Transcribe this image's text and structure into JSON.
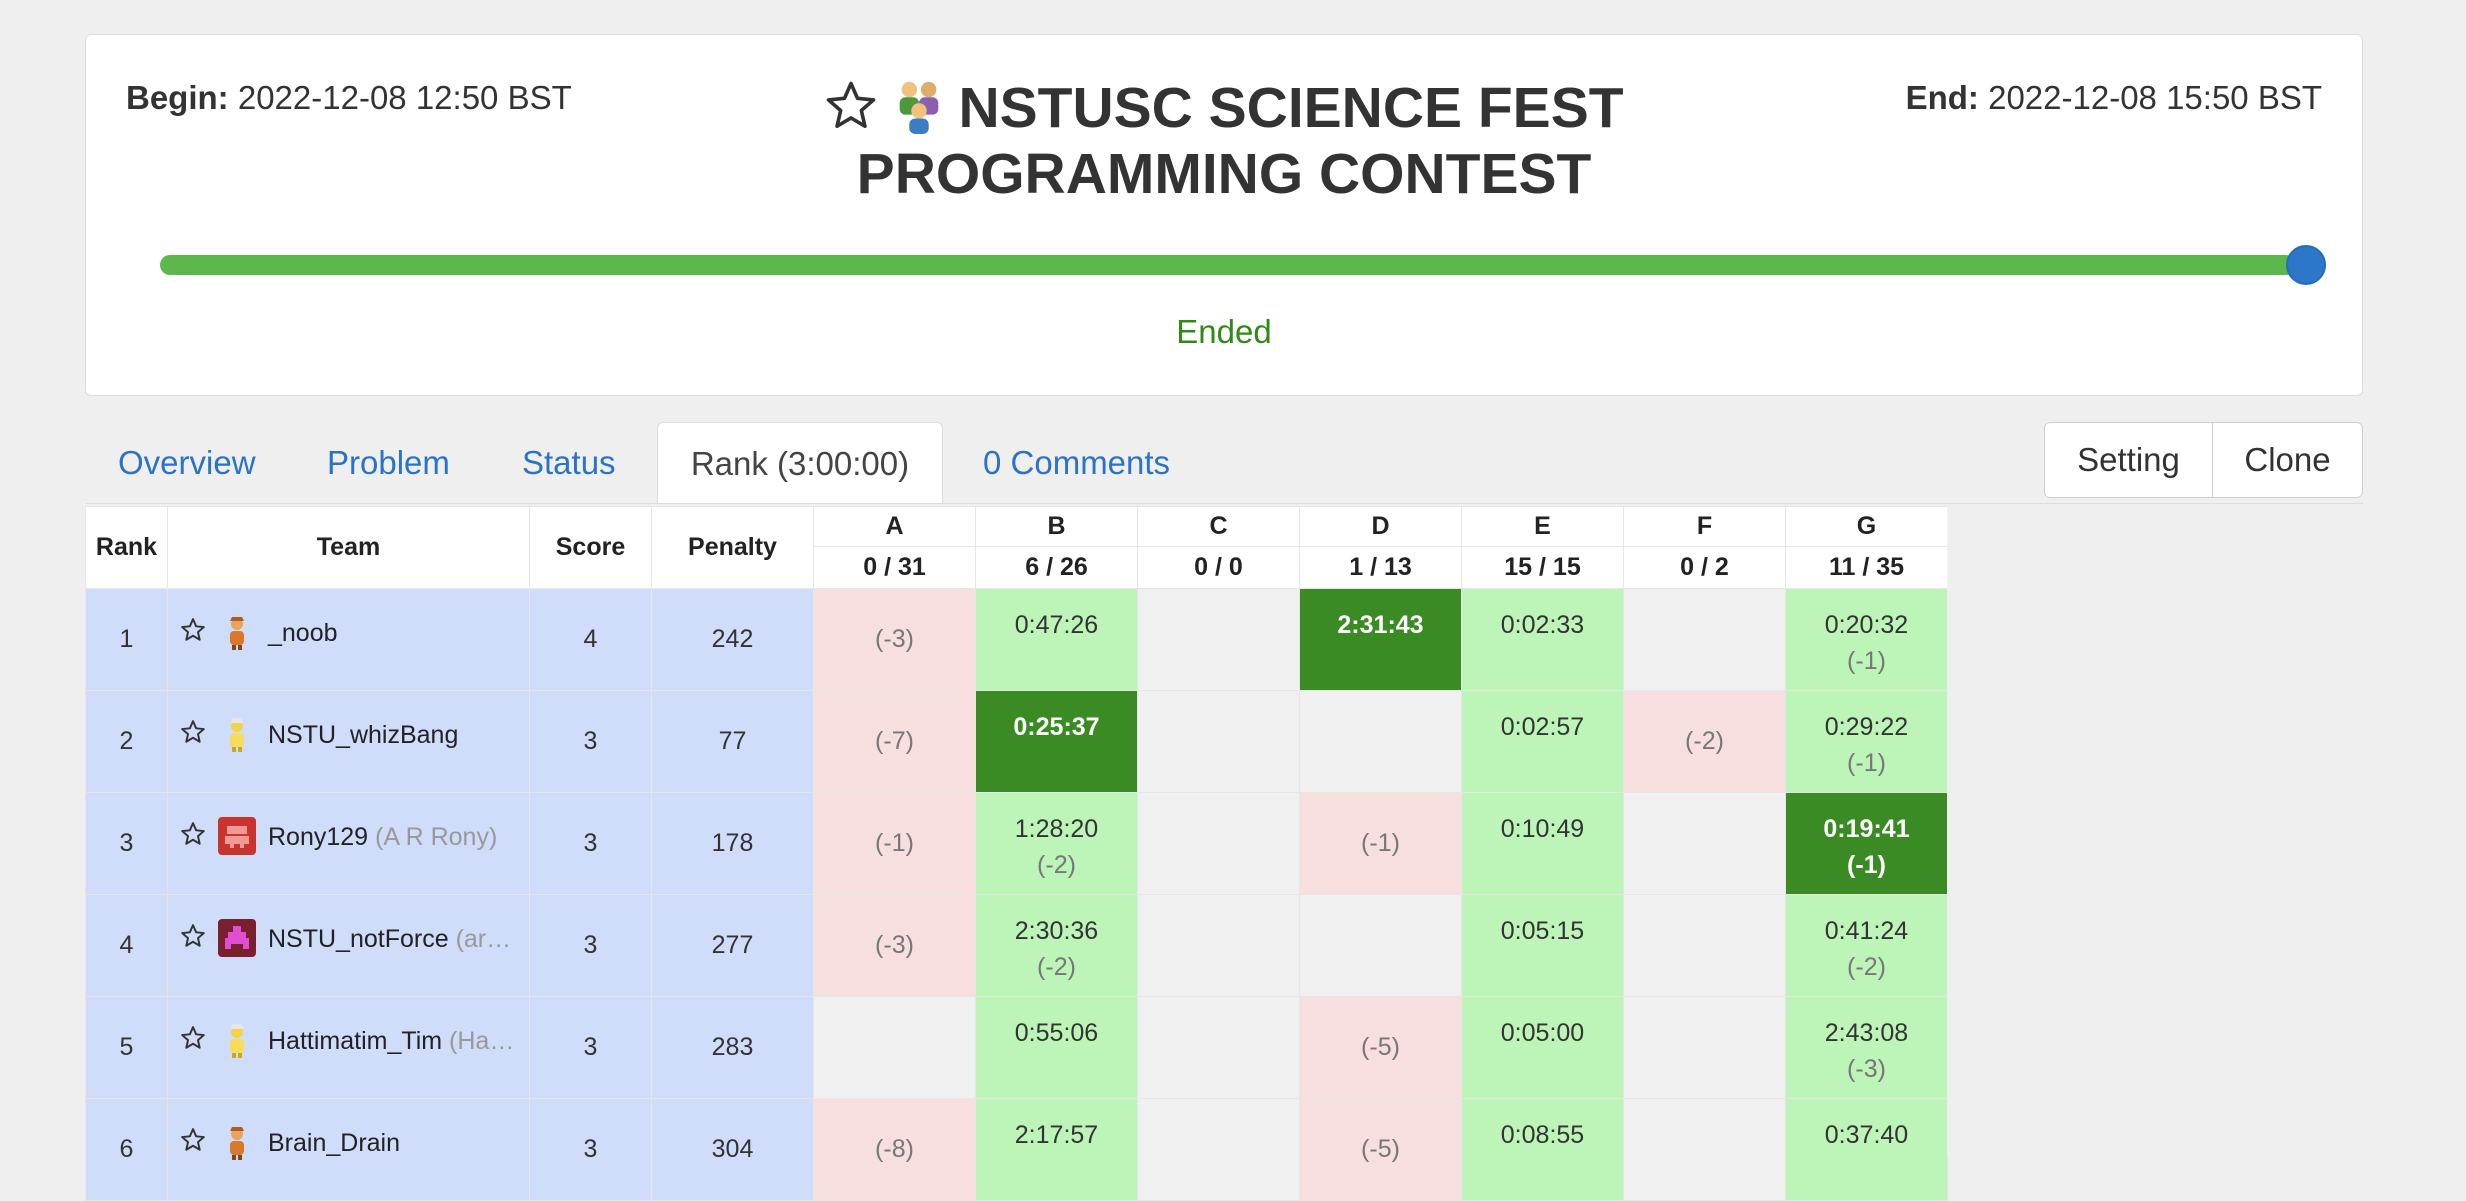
{
  "contest": {
    "begin_label": "Begin:",
    "begin_value": "2022-12-08 12:50 BST",
    "end_label": "End:",
    "end_value": "2022-12-08 15:50 BST",
    "title_line1": "NSTUSC SCIENCE FEST",
    "title_line2": "PROGRAMMING CONTEST",
    "progress": 1.0,
    "status": "Ended",
    "accent_color": "#5cb84c"
  },
  "tabs": [
    {
      "label": "Overview"
    },
    {
      "label": "Problem"
    },
    {
      "label": "Status"
    },
    {
      "label": "Rank (3:00:00)",
      "active": true
    },
    {
      "label": "0 Comments"
    }
  ],
  "buttons": {
    "setting": "Setting",
    "clone": "Clone"
  },
  "table": {
    "headers": {
      "rank": "Rank",
      "team": "Team",
      "score": "Score",
      "penalty": "Penalty"
    },
    "problems": [
      {
        "id": "A",
        "stat": "0 / 31"
      },
      {
        "id": "B",
        "stat": "6 / 26"
      },
      {
        "id": "C",
        "stat": "0 / 0"
      },
      {
        "id": "D",
        "stat": "1 / 13"
      },
      {
        "id": "E",
        "stat": "15 / 15"
      },
      {
        "id": "F",
        "stat": "0 / 2"
      },
      {
        "id": "G",
        "stat": "11 / 35"
      }
    ],
    "rows": [
      {
        "rank": "1",
        "name": "_noob",
        "real": "",
        "score": "4",
        "penalty": "242",
        "avatar": "orange-person",
        "cells": [
          {
            "s": "fail",
            "t": "",
            "w": "(-3)"
          },
          {
            "s": "ok",
            "t": "0:47:26",
            "w": ""
          },
          {
            "s": "empty",
            "t": "",
            "w": ""
          },
          {
            "s": "first",
            "t": "2:31:43",
            "w": ""
          },
          {
            "s": "ok",
            "t": "0:02:33",
            "w": ""
          },
          {
            "s": "empty",
            "t": "",
            "w": ""
          },
          {
            "s": "ok",
            "t": "0:20:32",
            "w": "(-1)"
          }
        ]
      },
      {
        "rank": "2",
        "name": "NSTU_whizBang",
        "real": "",
        "score": "3",
        "penalty": "77",
        "avatar": "yellow-person",
        "cells": [
          {
            "s": "fail",
            "t": "",
            "w": "(-7)"
          },
          {
            "s": "first",
            "t": "0:25:37",
            "w": ""
          },
          {
            "s": "empty",
            "t": "",
            "w": ""
          },
          {
            "s": "empty",
            "t": "",
            "w": ""
          },
          {
            "s": "ok",
            "t": "0:02:57",
            "w": ""
          },
          {
            "s": "fail",
            "t": "",
            "w": "(-2)"
          },
          {
            "s": "ok",
            "t": "0:29:22",
            "w": "(-1)"
          }
        ]
      },
      {
        "rank": "3",
        "name": "Rony129",
        "real": "(A R Rony)",
        "score": "3",
        "penalty": "178",
        "avatar": "red-block",
        "cells": [
          {
            "s": "fail",
            "t": "",
            "w": "(-1)"
          },
          {
            "s": "ok",
            "t": "1:28:20",
            "w": "(-2)"
          },
          {
            "s": "empty",
            "t": "",
            "w": ""
          },
          {
            "s": "fail",
            "t": "",
            "w": "(-1)"
          },
          {
            "s": "ok",
            "t": "0:10:49",
            "w": ""
          },
          {
            "s": "empty",
            "t": "",
            "w": ""
          },
          {
            "s": "first",
            "t": "0:19:41",
            "w": "(-1)"
          }
        ]
      },
      {
        "rank": "4",
        "name": "NSTU_notForce",
        "real": "(ar…",
        "score": "3",
        "penalty": "277",
        "avatar": "pink-block",
        "cells": [
          {
            "s": "fail",
            "t": "",
            "w": "(-3)"
          },
          {
            "s": "ok",
            "t": "2:30:36",
            "w": "(-2)"
          },
          {
            "s": "empty",
            "t": "",
            "w": ""
          },
          {
            "s": "empty",
            "t": "",
            "w": ""
          },
          {
            "s": "ok",
            "t": "0:05:15",
            "w": ""
          },
          {
            "s": "empty",
            "t": "",
            "w": ""
          },
          {
            "s": "ok",
            "t": "0:41:24",
            "w": "(-2)"
          }
        ]
      },
      {
        "rank": "5",
        "name": "Hattimatim_Tim",
        "real": "(Ha…",
        "score": "3",
        "penalty": "283",
        "avatar": "yellow-person",
        "cells": [
          {
            "s": "empty",
            "t": "",
            "w": ""
          },
          {
            "s": "ok",
            "t": "0:55:06",
            "w": ""
          },
          {
            "s": "empty",
            "t": "",
            "w": ""
          },
          {
            "s": "fail",
            "t": "",
            "w": "(-5)"
          },
          {
            "s": "ok",
            "t": "0:05:00",
            "w": ""
          },
          {
            "s": "empty",
            "t": "",
            "w": ""
          },
          {
            "s": "ok",
            "t": "2:43:08",
            "w": "(-3)"
          }
        ]
      },
      {
        "rank": "6",
        "name": "Brain_Drain",
        "real": "",
        "score": "3",
        "penalty": "304",
        "avatar": "orange-person",
        "cells": [
          {
            "s": "fail",
            "t": "",
            "w": "(-8)"
          },
          {
            "s": "ok",
            "t": "2:17:57",
            "w": ""
          },
          {
            "s": "empty",
            "t": "",
            "w": ""
          },
          {
            "s": "fail",
            "t": "",
            "w": "(-5)"
          },
          {
            "s": "ok",
            "t": "0:08:55",
            "w": ""
          },
          {
            "s": "empty",
            "t": "",
            "w": ""
          },
          {
            "s": "ok",
            "t": "0:37:40",
            "w": ""
          }
        ]
      }
    ]
  }
}
